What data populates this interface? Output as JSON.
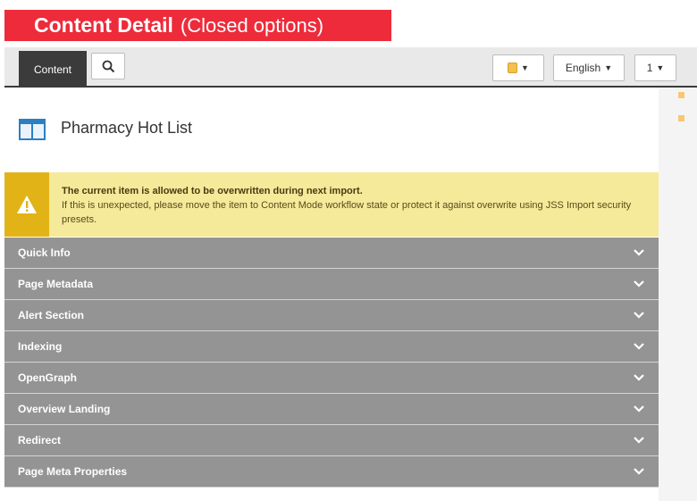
{
  "banner": {
    "bold": "Content Detail",
    "light": "(Closed options)"
  },
  "toolbar": {
    "tab_label": "Content",
    "language": "English",
    "version": "1"
  },
  "page": {
    "title": "Pharmacy Hot List"
  },
  "warning": {
    "title": "The current item is allowed to be overwritten during next import.",
    "body": "If this is unexpected, please move the item to Content Mode workflow state or protect it against overwrite using JSS Import security presets."
  },
  "sections": [
    {
      "label": "Quick Info"
    },
    {
      "label": "Page Metadata"
    },
    {
      "label": "Alert Section"
    },
    {
      "label": "Indexing"
    },
    {
      "label": "OpenGraph"
    },
    {
      "label": "Overview Landing"
    },
    {
      "label": "Redirect"
    },
    {
      "label": "Page Meta Properties"
    }
  ],
  "colors": {
    "banner": "#ee2b3b",
    "section_bg": "#949494",
    "warning_bg": "#f5e99a",
    "warning_accent": "#e2b317",
    "tab_active": "#3b3b3b"
  }
}
